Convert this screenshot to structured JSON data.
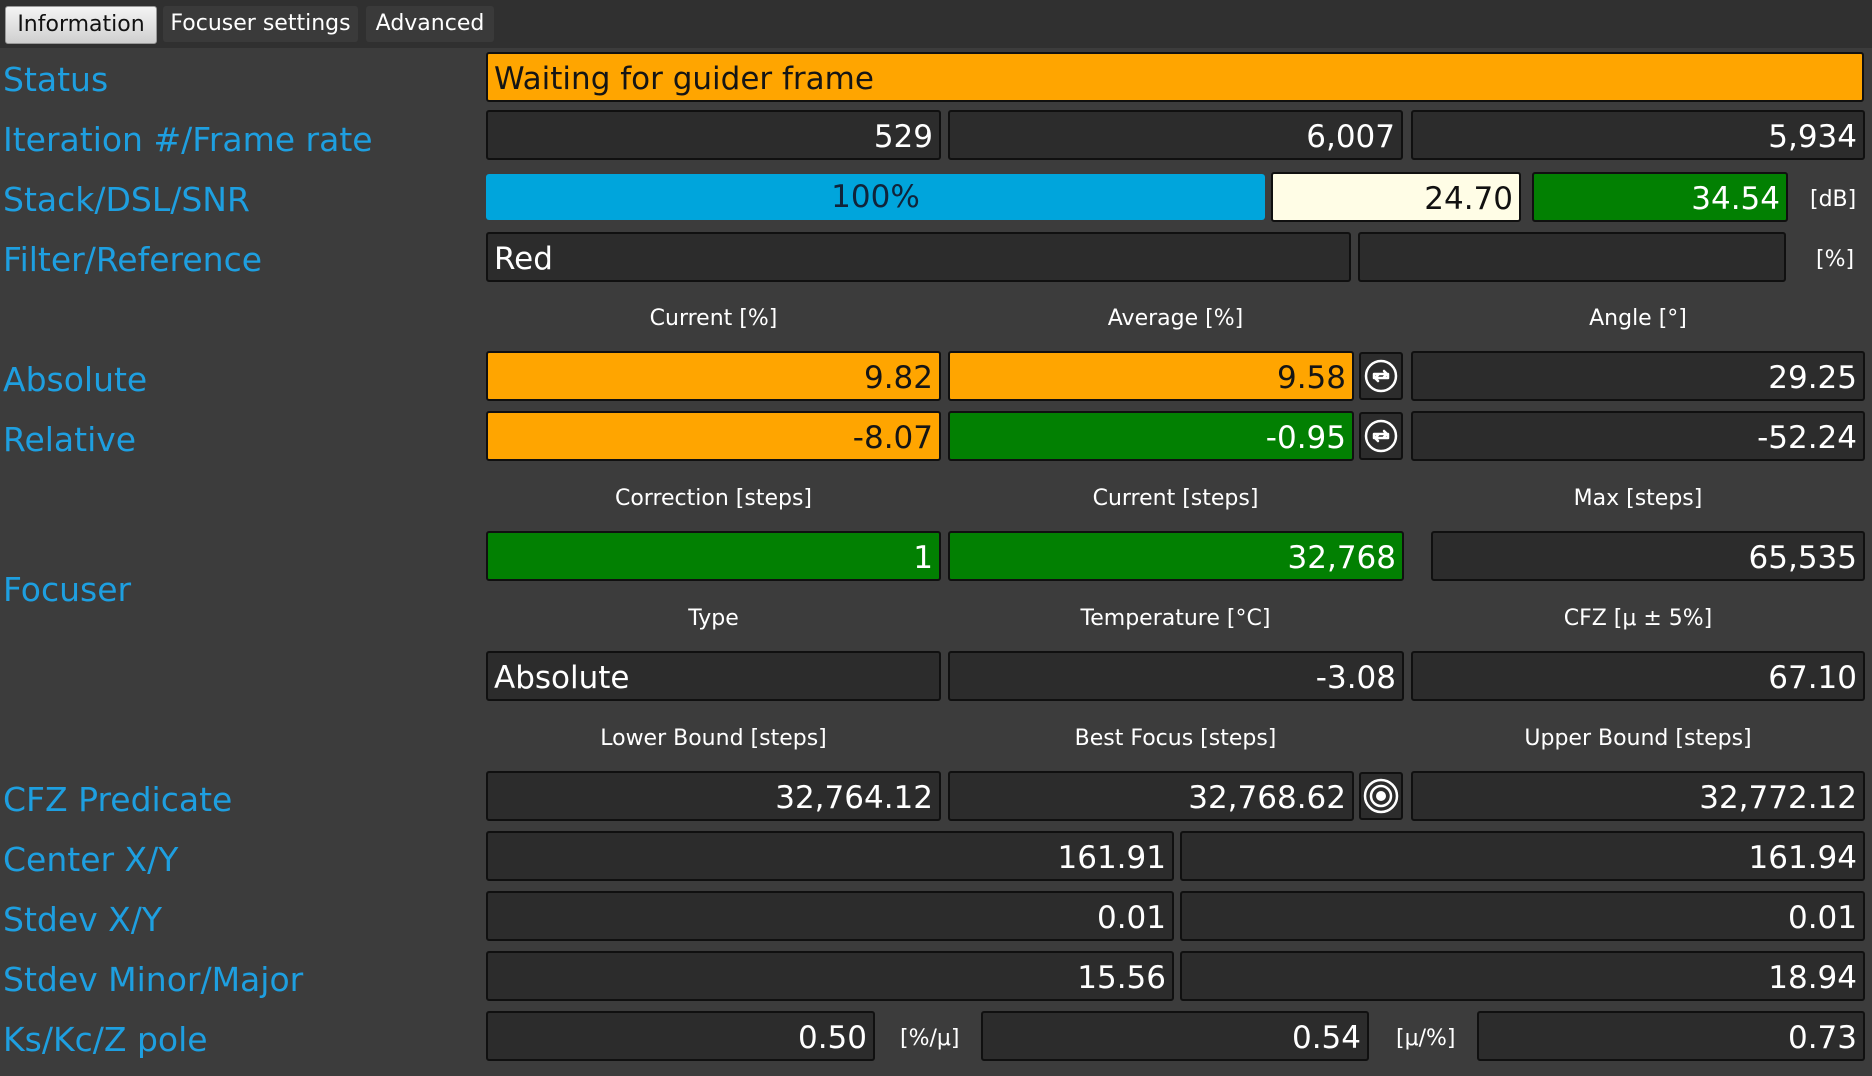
{
  "tabs": [
    {
      "label": "Information"
    },
    {
      "label": "Focuser settings"
    },
    {
      "label": "Advanced"
    }
  ],
  "labels": {
    "status": "Status",
    "iteration": "Iteration #/Frame rate",
    "stack": "Stack/DSL/SNR",
    "filter": "Filter/Reference",
    "absolute": "Absolute",
    "relative": "Relative",
    "focuser": "Focuser",
    "cfz_predicate": "CFZ Predicate",
    "center": "Center X/Y",
    "stdev": "Stdev X/Y",
    "stdev_minor_major": "Stdev Minor/Major",
    "ks": "Ks/Kc/Z pole"
  },
  "status": {
    "text": "Waiting for guider frame"
  },
  "iteration": {
    "iter": "529",
    "rate1": "6,007",
    "rate2": "5,934"
  },
  "stack": {
    "progress_text": "100%",
    "progress": 1.0,
    "dsl": "24.70",
    "snr": "34.54",
    "unit": "[dB]"
  },
  "filter": {
    "name": "Red",
    "reference": "",
    "unit": "[%]"
  },
  "ratio_headers": {
    "current": "Current [%]",
    "average": "Average [%]",
    "angle": "Angle [°]"
  },
  "absolute": {
    "current": "9.82",
    "average": "9.58",
    "angle": "29.25"
  },
  "relative": {
    "current": "-8.07",
    "average": "-0.95",
    "angle": "-52.24"
  },
  "focuser_headers1": {
    "correction": "Correction [steps]",
    "current": "Current [steps]",
    "max": "Max [steps]"
  },
  "focuser_row1": {
    "correction": "1",
    "current": "32,768",
    "max": "65,535"
  },
  "focuser_headers2": {
    "type": "Type",
    "temperature": "Temperature [°C]",
    "cfz": "CFZ [μ ± 5%]"
  },
  "focuser_row2": {
    "type": "Absolute",
    "temperature": "-3.08",
    "cfz": "67.10"
  },
  "cfz_headers": {
    "lower": "Lower Bound [steps]",
    "best": "Best Focus [steps]",
    "upper": "Upper Bound [steps]"
  },
  "cfz": {
    "lower": "32,764.12",
    "best": "32,768.62",
    "upper": "32,772.12"
  },
  "center": {
    "x": "161.91",
    "y": "161.94"
  },
  "stdev": {
    "x": "0.01",
    "y": "0.01"
  },
  "stdev_mm": {
    "minor": "15.56",
    "major": "18.94"
  },
  "ks": {
    "ks": "0.50",
    "ks_unit": "[%/μ]",
    "kc": "0.54",
    "kc_unit": "[μ/%]",
    "z": "0.73"
  },
  "icons": {
    "reset": "reset-icon",
    "target": "target-icon"
  }
}
